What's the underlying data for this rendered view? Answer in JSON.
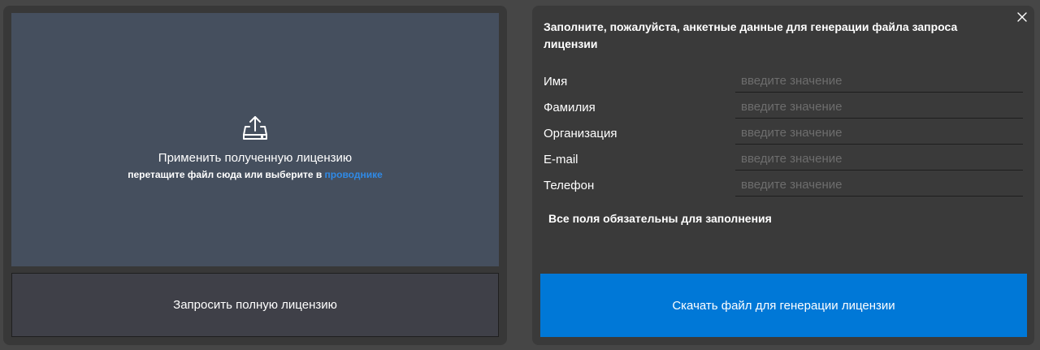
{
  "dropzone": {
    "icon": "upload-icon",
    "title": "Применить полученную лицензию",
    "subtitle_prefix": "перетащите файл сюда или выберите в ",
    "subtitle_link": "проводнике"
  },
  "request_button": {
    "label": "Запросить полную лицензию"
  },
  "form": {
    "close_icon": "close-icon",
    "title": "Заполните, пожалуйста, анкетные данные для генерации файла запроса лицензии",
    "fields": [
      {
        "label": "Имя",
        "value": "",
        "placeholder": "введите значение"
      },
      {
        "label": "Фамилия",
        "value": "",
        "placeholder": "введите значение"
      },
      {
        "label": "Организация",
        "value": "",
        "placeholder": "введите значение"
      },
      {
        "label": "E-mail",
        "value": "",
        "placeholder": "введите значение"
      },
      {
        "label": "Телефон",
        "value": "",
        "placeholder": "введите значение"
      }
    ],
    "required_note": "Все поля обязательны для заполнения",
    "download_label": "Скачать файл для генерации лицензии"
  },
  "colors": {
    "background": "#464646",
    "panel": "#383838",
    "dropzone": "#454f5e",
    "accent": "#0078d7",
    "link": "#2f8ae6"
  }
}
